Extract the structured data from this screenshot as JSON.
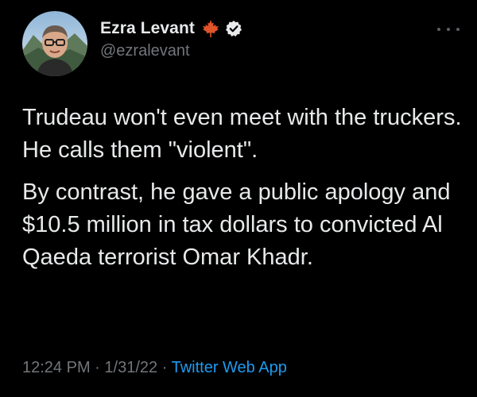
{
  "author": {
    "display_name": "Ezra Levant",
    "handle": "@ezralevant",
    "badge_emoji": "maple-leaf",
    "verified": true
  },
  "tweet": {
    "paragraphs": [
      "Trudeau won't even meet with the truckers. He calls them \"violent\".",
      "By contrast, he gave a public apology and $10.5 million in tax dollars to convicted Al Qaeda terrorist Omar Khadr."
    ],
    "time": "12:24 PM",
    "separator": "·",
    "date": "1/31/22",
    "source": "Twitter Web App"
  },
  "colors": {
    "background": "#000000",
    "text": "#e7e9ea",
    "muted": "#71767b",
    "link": "#1d9bf0",
    "maple": "#e0542b"
  },
  "icons": {
    "more": "more-icon",
    "maple": "maple-leaf-icon",
    "verified": "verified-badge-icon"
  }
}
